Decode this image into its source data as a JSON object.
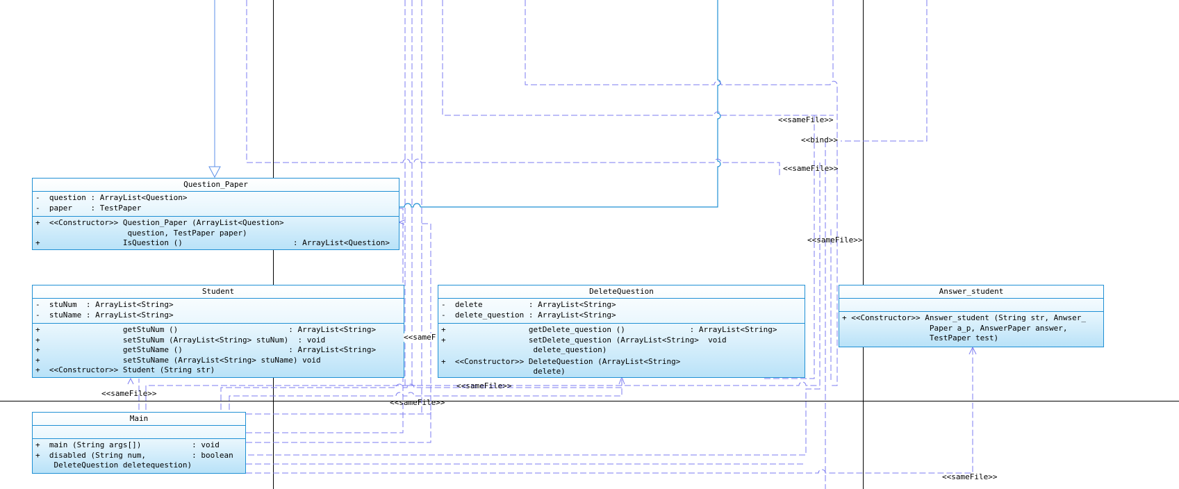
{
  "classes": {
    "question_paper": {
      "name": "Question_Paper",
      "attributes": [
        "-  question : ArrayList<Question>",
        "-  paper    : TestPaper"
      ],
      "operations": [
        "+  <<Constructor>> Question_Paper (ArrayList<Question>",
        "                    question, TestPaper paper)",
        "+                  IsQuestion ()                        : ArrayList<Question>"
      ]
    },
    "student": {
      "name": "Student",
      "attributes": [
        "-  stuNum  : ArrayList<String>",
        "-  stuName : ArrayList<String>"
      ],
      "operations": [
        "+                  getStuNum ()                        : ArrayList<String>",
        "+                  setStuNum (ArrayList<String> stuNum)  : void",
        "+                  getStuName ()                       : ArrayList<String>",
        "+                  setStuName (ArrayList<String> stuName) void",
        "+  <<Constructor>> Student (String str)"
      ]
    },
    "delete_question": {
      "name": "DeleteQuestion",
      "attributes": [
        "-  delete          : ArrayList<String>",
        "-  delete_question : ArrayList<String>"
      ],
      "operations": [
        "+                  getDelete_question ()              : ArrayList<String>",
        "+                  setDelete_question (ArrayList<String>  void",
        "                    delete_question)",
        "+  <<Constructor>> DeleteQuestion (ArrayList<String>",
        "                    delete)"
      ]
    },
    "answer_student": {
      "name": "Answer_student",
      "attributes": [],
      "operations": [
        "+ <<Constructor>> Answer_student (String str, Anwser_",
        "                   Paper a_p, AnswerPaper answer,",
        "                   TestPaper test)"
      ]
    },
    "main": {
      "name": "Main",
      "attributes": [],
      "operations": [
        "+  main (String args[])           : void",
        "+  disabled (String num,          : boolean",
        "    DeleteQuestion deletequestion)"
      ]
    }
  },
  "stereotype_labels": {
    "samefile_1": "<<sameFile>>",
    "bind": "<<bind>>",
    "samefile_2": "<<sameFile>>",
    "samefile_3": "<<sameFile>>",
    "samefile_student": "<<sameFile>>",
    "samefile_4": "<<sameFile>>",
    "samefile_5": "<<sameFile>>",
    "samefile_6": "<<sameFile>>",
    "samefile_clipped": "<<sameF"
  },
  "colors": {
    "class_border": "#1e8fd4",
    "dependency_line": "#7b7bf0",
    "association_line": "#1e8fd4",
    "grid_line": "#000000"
  }
}
